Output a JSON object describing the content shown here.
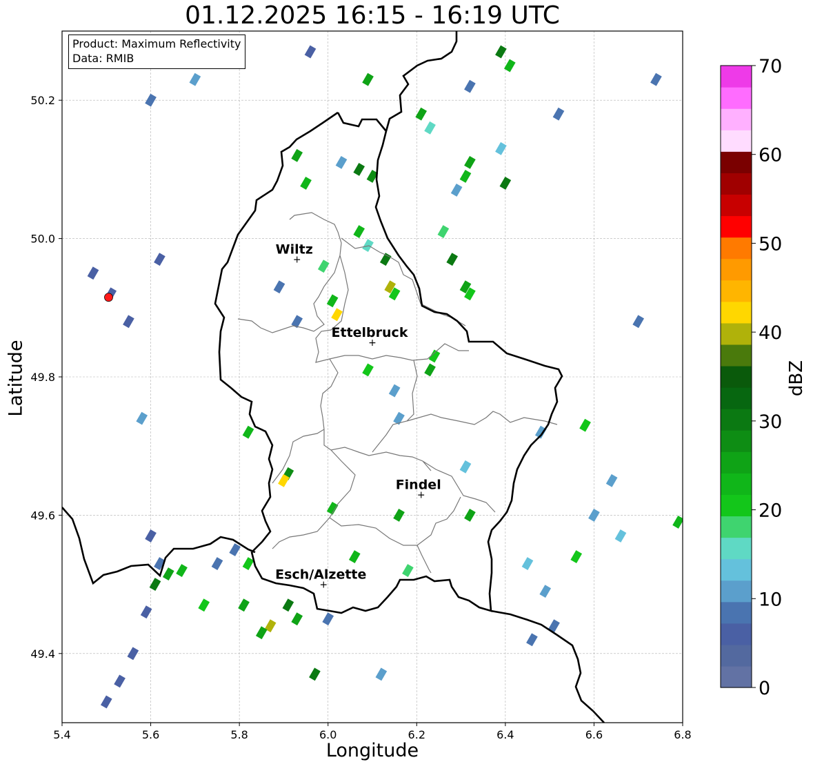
{
  "title": "01.12.2025 16:15 - 16:19 UTC",
  "product_line": "Product: Maximum Reflectivity",
  "data_line": "Data: RMIB",
  "x_axis": {
    "label": "Longitude",
    "range": [
      5.4,
      6.8
    ],
    "ticks": [
      "5.4",
      "5.6",
      "5.8",
      "6.0",
      "6.2",
      "6.4",
      "6.6",
      "6.8"
    ]
  },
  "y_axis": {
    "label": "Latitude",
    "range": [
      49.3,
      50.3
    ],
    "ticks": [
      "49.4",
      "49.6",
      "49.8",
      "50.0",
      "50.2"
    ]
  },
  "grid": true,
  "colorbar": {
    "label": "dBZ",
    "range": [
      0,
      70
    ],
    "ticks": [
      "0",
      "10",
      "20",
      "30",
      "40",
      "50",
      "60",
      "70"
    ],
    "colors": [
      "#6272a4",
      "#53699f",
      "#4a60a4",
      "#4a74b0",
      "#5b9fcc",
      "#64c1dc",
      "#5fd9c4",
      "#3fd46f",
      "#13c61a",
      "#10b619",
      "#0fa316",
      "#0e8d14",
      "#0b7912",
      "#076710",
      "#0a5a0b",
      "#4a7a0c",
      "#b0b20a",
      "#ffd700",
      "#ffb500",
      "#ff9a00",
      "#ff7a00",
      "#ff0000",
      "#c80000",
      "#a00000",
      "#7a0000",
      "#ffdcff",
      "#ffb0ff",
      "#ff6cff",
      "#ee3ae8"
    ]
  },
  "cities": [
    {
      "name": "Wiltz",
      "lon": 5.93,
      "lat": 49.97
    },
    {
      "name": "Ettelbruck",
      "lon": 6.1,
      "lat": 49.85
    },
    {
      "name": "Findel",
      "lon": 6.21,
      "lat": 49.63
    },
    {
      "name": "Esch/Alzette",
      "lon": 5.99,
      "lat": 49.5
    }
  ],
  "radar_site": {
    "lon": 5.505,
    "lat": 49.915,
    "color": "#ff1a1a"
  },
  "echoes": [
    {
      "lon": 5.62,
      "lat": 49.53,
      "dbz": 8
    },
    {
      "lon": 5.64,
      "lat": 49.515,
      "dbz": 25
    },
    {
      "lon": 5.61,
      "lat": 49.5,
      "dbz": 30
    },
    {
      "lon": 5.67,
      "lat": 49.52,
      "dbz": 22
    },
    {
      "lon": 5.72,
      "lat": 49.47,
      "dbz": 20
    },
    {
      "lon": 5.59,
      "lat": 49.46,
      "dbz": 6
    },
    {
      "lon": 5.56,
      "lat": 49.4,
      "dbz": 5
    },
    {
      "lon": 5.53,
      "lat": 49.36,
      "dbz": 5
    },
    {
      "lon": 5.5,
      "lat": 49.33,
      "dbz": 5
    },
    {
      "lon": 5.6,
      "lat": 49.57,
      "dbz": 6
    },
    {
      "lon": 5.58,
      "lat": 49.74,
      "dbz": 10
    },
    {
      "lon": 5.51,
      "lat": 49.92,
      "dbz": 5
    },
    {
      "lon": 5.47,
      "lat": 49.95,
      "dbz": 5
    },
    {
      "lon": 5.55,
      "lat": 49.88,
      "dbz": 6
    },
    {
      "lon": 5.62,
      "lat": 49.97,
      "dbz": 5
    },
    {
      "lon": 5.6,
      "lat": 50.2,
      "dbz": 8
    },
    {
      "lon": 5.7,
      "lat": 50.23,
      "dbz": 10
    },
    {
      "lon": 5.96,
      "lat": 50.27,
      "dbz": 6
    },
    {
      "lon": 5.91,
      "lat": 49.66,
      "dbz": 28
    },
    {
      "lon": 5.9,
      "lat": 49.65,
      "dbz": 42
    },
    {
      "lon": 6.01,
      "lat": 49.61,
      "dbz": 22
    },
    {
      "lon": 5.87,
      "lat": 49.44,
      "dbz": 40
    },
    {
      "lon": 5.85,
      "lat": 49.43,
      "dbz": 25
    },
    {
      "lon": 5.91,
      "lat": 49.47,
      "dbz": 30
    },
    {
      "lon": 5.93,
      "lat": 49.45,
      "dbz": 25
    },
    {
      "lon": 6.0,
      "lat": 49.45,
      "dbz": 9
    },
    {
      "lon": 5.97,
      "lat": 49.37,
      "dbz": 30
    },
    {
      "lon": 6.12,
      "lat": 49.37,
      "dbz": 12
    },
    {
      "lon": 6.06,
      "lat": 49.54,
      "dbz": 22
    },
    {
      "lon": 6.18,
      "lat": 49.52,
      "dbz": 18
    },
    {
      "lon": 6.16,
      "lat": 49.6,
      "dbz": 25
    },
    {
      "lon": 6.32,
      "lat": 49.6,
      "dbz": 26
    },
    {
      "lon": 6.31,
      "lat": 49.67,
      "dbz": 14
    },
    {
      "lon": 6.15,
      "lat": 49.78,
      "dbz": 10
    },
    {
      "lon": 6.16,
      "lat": 49.74,
      "dbz": 10
    },
    {
      "lon": 6.23,
      "lat": 49.81,
      "dbz": 26
    },
    {
      "lon": 6.24,
      "lat": 49.83,
      "dbz": 20
    },
    {
      "lon": 6.13,
      "lat": 49.97,
      "dbz": 30
    },
    {
      "lon": 6.14,
      "lat": 49.93,
      "dbz": 40
    },
    {
      "lon": 6.15,
      "lat": 49.92,
      "dbz": 20
    },
    {
      "lon": 6.01,
      "lat": 49.91,
      "dbz": 22
    },
    {
      "lon": 6.02,
      "lat": 49.89,
      "dbz": 42
    },
    {
      "lon": 5.93,
      "lat": 49.88,
      "dbz": 8
    },
    {
      "lon": 5.89,
      "lat": 49.93,
      "dbz": 8
    },
    {
      "lon": 5.99,
      "lat": 49.96,
      "dbz": 18
    },
    {
      "lon": 6.07,
      "lat": 50.01,
      "dbz": 24
    },
    {
      "lon": 6.09,
      "lat": 49.99,
      "dbz": 16
    },
    {
      "lon": 5.95,
      "lat": 50.08,
      "dbz": 22
    },
    {
      "lon": 5.93,
      "lat": 50.12,
      "dbz": 26
    },
    {
      "lon": 6.03,
      "lat": 50.11,
      "dbz": 12
    },
    {
      "lon": 6.07,
      "lat": 50.1,
      "dbz": 30
    },
    {
      "lon": 6.1,
      "lat": 50.09,
      "dbz": 28
    },
    {
      "lon": 6.09,
      "lat": 50.23,
      "dbz": 26
    },
    {
      "lon": 6.21,
      "lat": 50.18,
      "dbz": 26
    },
    {
      "lon": 6.23,
      "lat": 50.16,
      "dbz": 16
    },
    {
      "lon": 6.26,
      "lat": 50.01,
      "dbz": 18
    },
    {
      "lon": 6.28,
      "lat": 49.97,
      "dbz": 30
    },
    {
      "lon": 6.31,
      "lat": 49.93,
      "dbz": 26
    },
    {
      "lon": 6.32,
      "lat": 49.92,
      "dbz": 20
    },
    {
      "lon": 6.31,
      "lat": 50.09,
      "dbz": 24
    },
    {
      "lon": 6.32,
      "lat": 50.11,
      "dbz": 26
    },
    {
      "lon": 6.29,
      "lat": 50.07,
      "dbz": 12
    },
    {
      "lon": 6.39,
      "lat": 50.13,
      "dbz": 14
    },
    {
      "lon": 6.4,
      "lat": 50.08,
      "dbz": 30
    },
    {
      "lon": 6.39,
      "lat": 50.27,
      "dbz": 30
    },
    {
      "lon": 6.41,
      "lat": 50.25,
      "dbz": 22
    },
    {
      "lon": 6.32,
      "lat": 50.22,
      "dbz": 8
    },
    {
      "lon": 6.58,
      "lat": 49.73,
      "dbz": 20
    },
    {
      "lon": 6.48,
      "lat": 49.72,
      "dbz": 12
    },
    {
      "lon": 6.45,
      "lat": 49.53,
      "dbz": 14
    },
    {
      "lon": 6.49,
      "lat": 49.49,
      "dbz": 12
    },
    {
      "lon": 6.56,
      "lat": 49.54,
      "dbz": 20
    },
    {
      "lon": 6.64,
      "lat": 49.65,
      "dbz": 10
    },
    {
      "lon": 6.6,
      "lat": 49.6,
      "dbz": 12
    },
    {
      "lon": 6.66,
      "lat": 49.57,
      "dbz": 14
    },
    {
      "lon": 6.79,
      "lat": 49.59,
      "dbz": 22
    },
    {
      "lon": 6.46,
      "lat": 49.42,
      "dbz": 8
    },
    {
      "lon": 6.51,
      "lat": 49.44,
      "dbz": 8
    },
    {
      "lon": 6.7,
      "lat": 49.88,
      "dbz": 8
    },
    {
      "lon": 6.74,
      "lat": 50.23,
      "dbz": 8
    },
    {
      "lon": 6.52,
      "lat": 50.18,
      "dbz": 8
    },
    {
      "lon": 5.82,
      "lat": 49.53,
      "dbz": 20
    },
    {
      "lon": 5.79,
      "lat": 49.55,
      "dbz": 8
    },
    {
      "lon": 5.81,
      "lat": 49.47,
      "dbz": 26
    },
    {
      "lon": 5.75,
      "lat": 49.53,
      "dbz": 8
    },
    {
      "lon": 5.82,
      "lat": 49.72,
      "dbz": 24
    },
    {
      "lon": 6.09,
      "lat": 49.81,
      "dbz": 20
    }
  ]
}
